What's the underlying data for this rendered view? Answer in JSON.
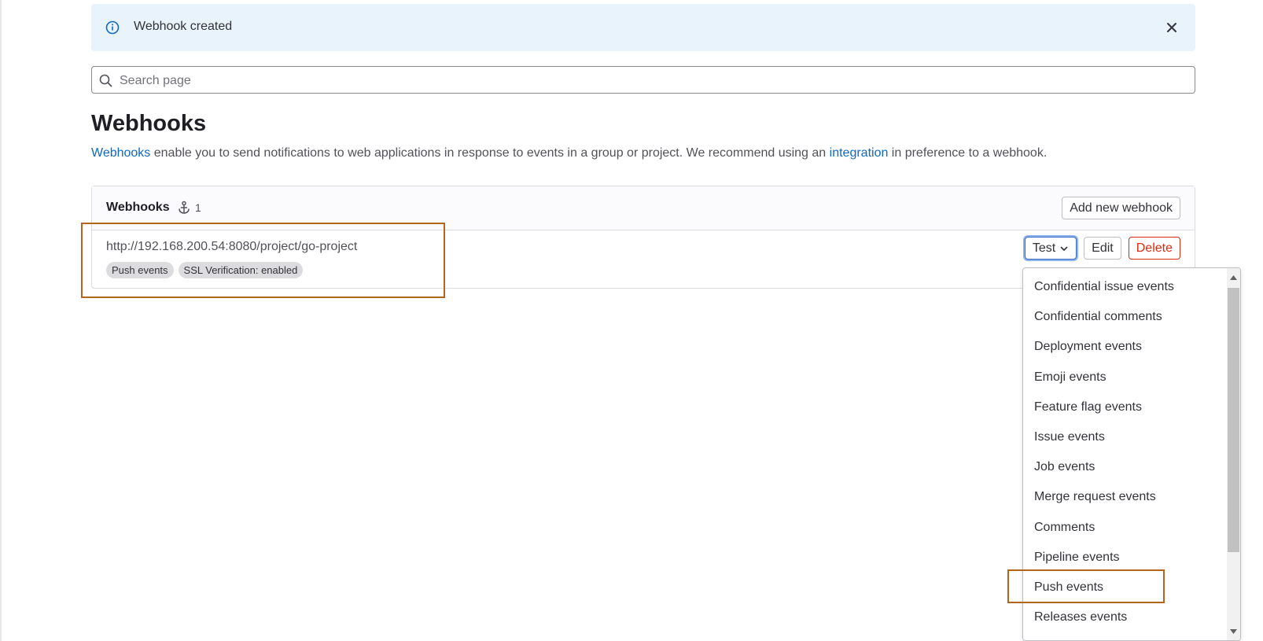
{
  "alert": {
    "message": "Webhook created",
    "info_icon": "info-circle-icon",
    "close_icon": "close-icon",
    "accent": "#1068bf",
    "background": "#e9f3fc"
  },
  "search": {
    "placeholder": "Search page",
    "value": "",
    "icon": "search-icon"
  },
  "page": {
    "title": "Webhooks",
    "description_link1": "Webhooks",
    "description_text1": " enable you to send notifications to web applications in response to events in a group or project. We recommend using an ",
    "description_link2": "integration",
    "description_text2": " in preference to a webhook.",
    "link_color": "#1068bf"
  },
  "webhooks_card": {
    "title": "Webhooks",
    "count": "1",
    "count_icon": "webhook-icon",
    "add_button": "Add new webhook"
  },
  "webhook": {
    "url": "http://192.168.200.54:8080/project/go-project",
    "badges": [
      "Push events",
      "SSL Verification: enabled"
    ],
    "test_button": "Test",
    "test_icon": "chevron-down-icon",
    "edit_button": "Edit",
    "delete_button": "Delete",
    "delete_color": "#dd2b0e"
  },
  "test_dropdown": {
    "items": [
      "Confidential issue events",
      "Confidential comments",
      "Deployment events",
      "Emoji events",
      "Feature flag events",
      "Issue events",
      "Job events",
      "Merge request events",
      "Comments",
      "Pipeline events",
      "Push events",
      "Releases events"
    ],
    "highlighted": "Push events"
  },
  "annotation_color": "#b4651b"
}
